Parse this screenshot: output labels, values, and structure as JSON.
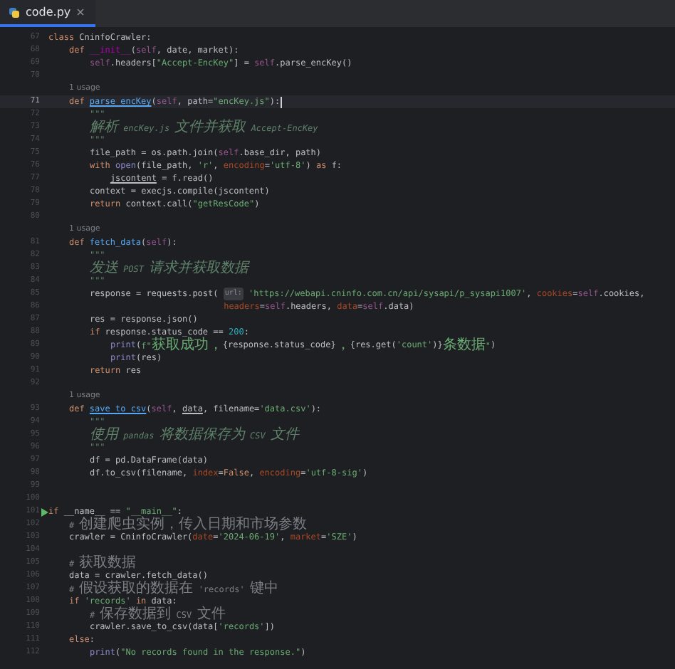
{
  "tab": {
    "label": "code.py",
    "selected": true
  },
  "lines": [
    {
      "kind": "code",
      "number": "67",
      "tokens": [
        {
          "text": "class",
          "kind": "kw"
        },
        {
          "text": " CninfoCrawler:",
          "kind": "plain"
        }
      ],
      "children": [
        {
          "kind": "code",
          "number": "68",
          "tokens": [
            {
              "text": "def ",
              "kind": "kw"
            },
            {
              "text": "__init__",
              "kind": "dunder"
            },
            {
              "text": "(",
              "kind": "plain"
            },
            {
              "text": "self",
              "kind": "self"
            },
            {
              "text": ", date, market):",
              "kind": "plain"
            }
          ],
          "children": [
            {
              "kind": "code",
              "number": "69",
              "tokens": [
                {
                  "text": "self",
                  "kind": "self"
                },
                {
                  "text": ".headers[",
                  "kind": "plain"
                },
                {
                  "text": "\"Accept-EncKey\"",
                  "kind": "str"
                },
                {
                  "text": "] = ",
                  "kind": "plain"
                },
                {
                  "text": "self",
                  "kind": "self"
                },
                {
                  "text": ".parse_encKey()",
                  "kind": "plain"
                }
              ]
            },
            {
              "kind": "code",
              "number": "70"
            }
          ]
        },
        {
          "kind": "code",
          "number": "71",
          "usage": "1 usage",
          "current": true,
          "tokens": [
            {
              "text": "def ",
              "kind": "kw"
            },
            {
              "text": "parse_encKey",
              "kind": "fnu"
            },
            {
              "text": "(",
              "kind": "plain"
            },
            {
              "text": "self",
              "kind": "self"
            },
            {
              "text": ", path=",
              "kind": "plain"
            },
            {
              "text": "\"encKey.js\"",
              "kind": "str"
            },
            {
              "text": "):",
              "kind": "plain"
            }
          ],
          "children": [
            {
              "kind": "code",
              "number": "72",
              "tokens": [
                {
                  "text": "\"\"\"",
                  "kind": "doc"
                }
              ]
            },
            {
              "kind": "code",
              "number": "73",
              "tokens": [
                {
                  "text": "解析 encKey.js 文件并获取 Accept-EncKey",
                  "kind": "doc"
                }
              ]
            },
            {
              "kind": "code",
              "number": "74",
              "tokens": [
                {
                  "text": "\"\"\"",
                  "kind": "doc"
                }
              ]
            },
            {
              "kind": "code",
              "number": "75",
              "tokens": [
                {
                  "text": "file_path = os.path.join(",
                  "kind": "plain"
                },
                {
                  "text": "self",
                  "kind": "self"
                },
                {
                  "text": ".base_dir, path)",
                  "kind": "plain"
                }
              ]
            },
            {
              "kind": "code",
              "number": "76",
              "tokens": [
                {
                  "text": "with ",
                  "kind": "kw"
                },
                {
                  "text": "open",
                  "kind": "builtin"
                },
                {
                  "text": "(file_path, ",
                  "kind": "plain"
                },
                {
                  "text": "'r'",
                  "kind": "str"
                },
                {
                  "text": ", ",
                  "kind": "plain"
                },
                {
                  "text": "encoding",
                  "kind": "param"
                },
                {
                  "text": "=",
                  "kind": "plain"
                },
                {
                  "text": "'utf-8'",
                  "kind": "str"
                },
                {
                  "text": ") ",
                  "kind": "plain"
                },
                {
                  "text": "as ",
                  "kind": "kw"
                },
                {
                  "text": "f:",
                  "kind": "plain"
                }
              ],
              "children": [
                {
                  "kind": "code",
                  "number": "77",
                  "tokens": [
                    {
                      "text": "jscontent",
                      "kind": "under"
                    },
                    {
                      "text": " = f.read()",
                      "kind": "plain"
                    }
                  ]
                }
              ]
            },
            {
              "kind": "code",
              "number": "78",
              "tokens": [
                {
                  "text": "context = execjs.compile(jscontent)",
                  "kind": "plain"
                }
              ]
            },
            {
              "kind": "code",
              "number": "79",
              "tokens": [
                {
                  "text": "return ",
                  "kind": "kw"
                },
                {
                  "text": "context.call(",
                  "kind": "plain"
                },
                {
                  "text": "\"getResCode\"",
                  "kind": "str"
                },
                {
                  "text": ")",
                  "kind": "plain"
                }
              ]
            },
            {
              "kind": "code",
              "number": "80"
            }
          ]
        },
        {
          "kind": "code",
          "number": "81",
          "usage": "1 usage",
          "tokens": [
            {
              "text": "def ",
              "kind": "kw"
            },
            {
              "text": "fetch_data",
              "kind": "fn"
            },
            {
              "text": "(",
              "kind": "plain"
            },
            {
              "text": "self",
              "kind": "self"
            },
            {
              "text": "):",
              "kind": "plain"
            }
          ],
          "children": [
            {
              "kind": "code",
              "number": "82",
              "tokens": [
                {
                  "text": "\"\"\"",
                  "kind": "doc"
                }
              ]
            },
            {
              "kind": "code",
              "number": "83",
              "tokens": [
                {
                  "text": "发送 POST 请求并获取数据",
                  "kind": "doc"
                }
              ]
            },
            {
              "kind": "code",
              "number": "84",
              "tokens": [
                {
                  "text": "\"\"\"",
                  "kind": "doc"
                }
              ]
            },
            {
              "kind": "code",
              "number": "85",
              "tokens": [
                {
                  "text": "response = requests.post( ",
                  "kind": "plain"
                },
                {
                  "text": "url:",
                  "kind": "hint"
                },
                {
                  "text": " 'https://webapi.cninfo.com.cn/api/sysapi/p_sysapi1007'",
                  "kind": "str"
                },
                {
                  "text": ", ",
                  "kind": "plain"
                },
                {
                  "text": "cookies",
                  "kind": "param"
                },
                {
                  "text": "=",
                  "kind": "plain"
                },
                {
                  "text": "self",
                  "kind": "self"
                },
                {
                  "text": ".cookies,",
                  "kind": "plain"
                }
              ]
            },
            {
              "kind": "continuation",
              "number": "86",
              "tokens": [
                {
                  "text": "headers",
                  "kind": "param"
                },
                {
                  "text": "=",
                  "kind": "plain"
                },
                {
                  "text": "self",
                  "kind": "self"
                },
                {
                  "text": ".headers, ",
                  "kind": "plain"
                },
                {
                  "text": "data",
                  "kind": "param"
                },
                {
                  "text": "=",
                  "kind": "plain"
                },
                {
                  "text": "self",
                  "kind": "self"
                },
                {
                  "text": ".data)",
                  "kind": "plain"
                }
              ]
            },
            {
              "kind": "code",
              "number": "87",
              "tokens": [
                {
                  "text": "res = response.json()",
                  "kind": "plain"
                }
              ]
            },
            {
              "kind": "code",
              "number": "88",
              "tokens": [
                {
                  "text": "if ",
                  "kind": "kw"
                },
                {
                  "text": "response.status_code == ",
                  "kind": "plain"
                },
                {
                  "text": "200",
                  "kind": "num"
                },
                {
                  "text": ":",
                  "kind": "plain"
                }
              ],
              "children": [
                {
                  "kind": "code",
                  "number": "89",
                  "tokens": [
                    {
                      "text": "print",
                      "kind": "builtin"
                    },
                    {
                      "text": "(",
                      "kind": "plain"
                    },
                    {
                      "text": "f\"获取成功，",
                      "kind": "str"
                    },
                    {
                      "text": "{response.status_code}",
                      "kind": "plain"
                    },
                    {
                      "text": "，",
                      "kind": "str"
                    },
                    {
                      "text": "{res.get(",
                      "kind": "plain"
                    },
                    {
                      "text": "'count'",
                      "kind": "str"
                    },
                    {
                      "text": ")}",
                      "kind": "plain"
                    },
                    {
                      "text": "条数据\"",
                      "kind": "str"
                    },
                    {
                      "text": ")",
                      "kind": "plain"
                    }
                  ]
                },
                {
                  "kind": "code",
                  "number": "90",
                  "tokens": [
                    {
                      "text": "print",
                      "kind": "builtin"
                    },
                    {
                      "text": "(res)",
                      "kind": "plain"
                    }
                  ]
                }
              ]
            },
            {
              "kind": "code",
              "number": "91",
              "tokens": [
                {
                  "text": "return ",
                  "kind": "kw"
                },
                {
                  "text": "res",
                  "kind": "plain"
                }
              ]
            },
            {
              "kind": "code",
              "number": "92"
            }
          ]
        },
        {
          "kind": "code",
          "number": "93",
          "usage": "1 usage",
          "tokens": [
            {
              "text": "def ",
              "kind": "kw"
            },
            {
              "text": "save_to_csv",
              "kind": "fnu"
            },
            {
              "text": "(",
              "kind": "plain"
            },
            {
              "text": "self",
              "kind": "self"
            },
            {
              "text": ", ",
              "kind": "plain"
            },
            {
              "text": "data",
              "kind": "under"
            },
            {
              "text": ", filename=",
              "kind": "plain"
            },
            {
              "text": "'data.csv'",
              "kind": "str"
            },
            {
              "text": "):",
              "kind": "plain"
            }
          ],
          "children": [
            {
              "kind": "code",
              "number": "94",
              "tokens": [
                {
                  "text": "\"\"\"",
                  "kind": "doc"
                }
              ]
            },
            {
              "kind": "code",
              "number": "95",
              "tokens": [
                {
                  "text": "使用 pandas 将数据保存为 CSV 文件",
                  "kind": "doc"
                }
              ]
            },
            {
              "kind": "code",
              "number": "96",
              "tokens": [
                {
                  "text": "\"\"\"",
                  "kind": "doc"
                }
              ]
            },
            {
              "kind": "code",
              "number": "97",
              "tokens": [
                {
                  "text": "df = pd.DataFrame(data)",
                  "kind": "plain"
                }
              ]
            },
            {
              "kind": "code",
              "number": "98",
              "tokens": [
                {
                  "text": "df.to_csv(filename, ",
                  "kind": "plain"
                },
                {
                  "text": "index",
                  "kind": "param"
                },
                {
                  "text": "=",
                  "kind": "plain"
                },
                {
                  "text": "False",
                  "kind": "kw"
                },
                {
                  "text": ", ",
                  "kind": "plain"
                },
                {
                  "text": "encoding",
                  "kind": "param"
                },
                {
                  "text": "=",
                  "kind": "plain"
                },
                {
                  "text": "'utf-8-sig'",
                  "kind": "str"
                },
                {
                  "text": ")",
                  "kind": "plain"
                }
              ]
            }
          ]
        }
      ]
    },
    {
      "kind": "code",
      "number": "99"
    },
    {
      "kind": "code",
      "number": "100"
    },
    {
      "kind": "code",
      "number": "101",
      "run": true,
      "tokens": [
        {
          "text": "if ",
          "kind": "kw"
        },
        {
          "text": "__name__ == ",
          "kind": "plain"
        },
        {
          "text": "\"__main__\"",
          "kind": "str"
        },
        {
          "text": ":",
          "kind": "plain"
        }
      ],
      "children": [
        {
          "kind": "code",
          "number": "102",
          "tokens": [
            {
              "text": "# 创建爬虫实例，传入日期和市场参数",
              "kind": "comment"
            }
          ]
        },
        {
          "kind": "code",
          "number": "103",
          "tokens": [
            {
              "text": "crawler = CninfoCrawler(",
              "kind": "plain"
            },
            {
              "text": "date",
              "kind": "param"
            },
            {
              "text": "=",
              "kind": "plain"
            },
            {
              "text": "'2024-06-19'",
              "kind": "str"
            },
            {
              "text": ", ",
              "kind": "plain"
            },
            {
              "text": "market",
              "kind": "param"
            },
            {
              "text": "=",
              "kind": "plain"
            },
            {
              "text": "'SZE'",
              "kind": "str"
            },
            {
              "text": ")",
              "kind": "plain"
            }
          ]
        },
        {
          "kind": "code",
          "number": "104"
        },
        {
          "kind": "code",
          "number": "105",
          "tokens": [
            {
              "text": "# 获取数据",
              "kind": "comment"
            }
          ]
        },
        {
          "kind": "code",
          "number": "106",
          "tokens": [
            {
              "text": "data = crawler.fetch_data()",
              "kind": "plain"
            }
          ]
        },
        {
          "kind": "code",
          "number": "107",
          "tokens": [
            {
              "text": "# 假设获取的数据在 'records' 键中",
              "kind": "comment"
            }
          ]
        },
        {
          "kind": "code",
          "number": "108",
          "tokens": [
            {
              "text": "if ",
              "kind": "kw"
            },
            {
              "text": "'records'",
              "kind": "str"
            },
            {
              "text": " in ",
              "kind": "kw"
            },
            {
              "text": "data:",
              "kind": "plain"
            }
          ],
          "children": [
            {
              "kind": "code",
              "number": "109",
              "tokens": [
                {
                  "text": "# 保存数据到 CSV 文件",
                  "kind": "comment"
                }
              ]
            },
            {
              "kind": "code",
              "number": "110",
              "tokens": [
                {
                  "text": "crawler.save_to_csv(data[",
                  "kind": "plain"
                },
                {
                  "text": "'records'",
                  "kind": "str"
                },
                {
                  "text": "])",
                  "kind": "plain"
                }
              ]
            }
          ]
        },
        {
          "kind": "code",
          "number": "111",
          "tokens": [
            {
              "text": "else",
              "kind": "kw"
            },
            {
              "text": ":",
              "kind": "plain"
            }
          ],
          "children": [
            {
              "kind": "code",
              "number": "112",
              "tokens": [
                {
                  "text": "print",
                  "kind": "builtin"
                },
                {
                  "text": "(",
                  "kind": "plain"
                },
                {
                  "text": "\"No records found in the response.\"",
                  "kind": "str"
                },
                {
                  "text": ")",
                  "kind": "plain"
                }
              ]
            }
          ]
        }
      ]
    }
  ]
}
